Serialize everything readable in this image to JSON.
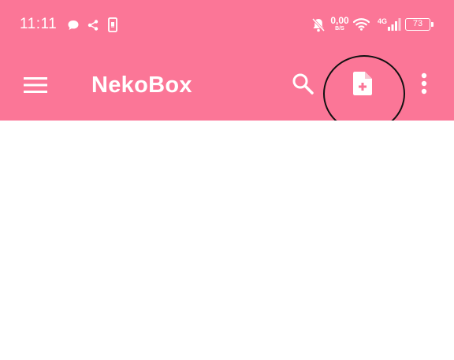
{
  "status_bar": {
    "time": "11:11",
    "net_speed_value": "0,00",
    "net_speed_unit": "B/S",
    "network_type": "4G",
    "battery_level": "73"
  },
  "app_bar": {
    "title": "NekoBox"
  },
  "icons": {
    "menu": "hamburger-menu-icon",
    "search": "search-icon",
    "new_profile": "new-file-icon",
    "overflow": "more-vert-icon"
  },
  "colors": {
    "app_bar": "#fb7697",
    "foreground": "#ffffff",
    "annotation": "#111111"
  }
}
